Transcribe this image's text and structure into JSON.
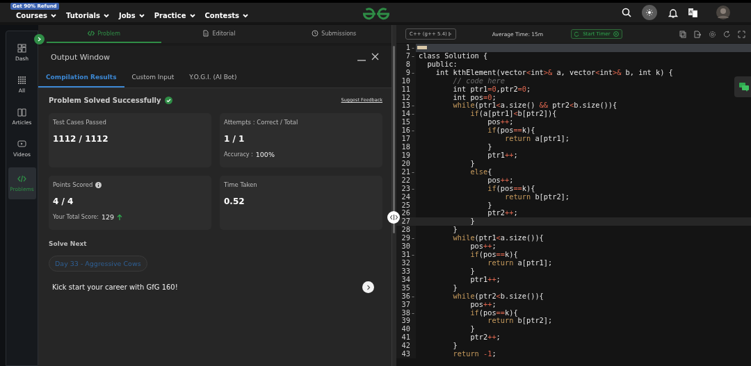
{
  "promo_badge": "Get 90% Refund",
  "nav": {
    "items": [
      {
        "label": "Courses"
      },
      {
        "label": "Tutorials"
      },
      {
        "label": "Jobs"
      },
      {
        "label": "Practice"
      },
      {
        "label": "Contests"
      }
    ]
  },
  "sidebar": {
    "items": [
      {
        "label": "Dash",
        "selected": false
      },
      {
        "label": "All",
        "selected": false
      },
      {
        "label": "Articles",
        "selected": false
      },
      {
        "label": "Videos",
        "selected": false
      },
      {
        "label": "Problems",
        "selected": true
      }
    ]
  },
  "problem_tabs": [
    {
      "label": "Problem",
      "selected": true
    },
    {
      "label": "Editorial",
      "selected": false
    },
    {
      "label": "Submissions",
      "selected": false
    }
  ],
  "output_window": {
    "title": "Output Window",
    "tabs": [
      {
        "label": "Compilation Results",
        "selected": true
      },
      {
        "label": "Custom Input",
        "selected": false
      },
      {
        "label": "Y.O.G.I. (AI Bot)",
        "selected": false
      }
    ],
    "status": "Problem Solved Successfully",
    "feedback_link": "Suggest Feedback",
    "cards": [
      {
        "label": "Test Cases Passed",
        "value": "1112 / 1112"
      },
      {
        "label": "Attempts : Correct / Total",
        "value": "1 / 1",
        "detail_label": "Accuracy :",
        "detail_value": "100%"
      },
      {
        "label": "Points Scored",
        "value": "4 / 4",
        "info": true,
        "detail_label": "Your Total Score:",
        "detail_value": "129",
        "score_increased": true
      },
      {
        "label": "Time Taken",
        "value": "0.52"
      }
    ],
    "solve_next": {
      "heading": "Solve Next",
      "chip": "Day 33 - Aggressive Cows",
      "promo": "Kick start your career with GfG 160!"
    }
  },
  "editor": {
    "language": "C++ (g++ 5.4)",
    "average_time": "Average Time: 15m",
    "timer_button": "Start Timer",
    "lines": [
      {
        "n": "1",
        "fold": true,
        "folded": true,
        "active": false
      },
      {
        "n": "7",
        "fold": true,
        "active": false,
        "segs": [
          {
            "t": "class Solution {",
            "kind": "plain"
          }
        ]
      },
      {
        "n": "8",
        "fold": false,
        "active": false,
        "segs": [
          {
            "t": "  public:",
            "kind": "plain"
          }
        ]
      },
      {
        "n": "9",
        "fold": true,
        "active": false,
        "segs": [
          {
            "t": "    int kthElement(vector",
            "kind": "plain"
          },
          {
            "t": "<",
            "kind": "op"
          },
          {
            "t": "int",
            "kind": "plain"
          },
          {
            "t": ">&",
            "kind": "op"
          },
          {
            "t": " a, vector",
            "kind": "plain"
          },
          {
            "t": "<",
            "kind": "op"
          },
          {
            "t": "int",
            "kind": "plain"
          },
          {
            "t": ">&",
            "kind": "op"
          },
          {
            "t": " b, int k) {",
            "kind": "plain"
          }
        ]
      },
      {
        "n": "10",
        "fold": false,
        "active": false,
        "segs": [
          {
            "t": "        // code here",
            "kind": "comment"
          }
        ]
      },
      {
        "n": "11",
        "fold": false,
        "active": false,
        "segs": [
          {
            "t": "        int ptr1",
            "kind": "plain"
          },
          {
            "t": "=0",
            "kind": "op"
          },
          {
            "t": ",ptr2",
            "kind": "plain"
          },
          {
            "t": "=0",
            "kind": "op"
          },
          {
            "t": ";",
            "kind": "plain"
          }
        ]
      },
      {
        "n": "12",
        "fold": false,
        "active": false,
        "segs": [
          {
            "t": "        int pos",
            "kind": "plain"
          },
          {
            "t": "=0",
            "kind": "op"
          },
          {
            "t": ";",
            "kind": "plain"
          }
        ]
      },
      {
        "n": "13",
        "fold": true,
        "active": false,
        "segs": [
          {
            "t": "        while",
            "kind": "keyword"
          },
          {
            "t": "(ptr1",
            "kind": "plain"
          },
          {
            "t": "<",
            "kind": "op"
          },
          {
            "t": "a.size() ",
            "kind": "plain"
          },
          {
            "t": "&&",
            "kind": "op"
          },
          {
            "t": " ptr2",
            "kind": "plain"
          },
          {
            "t": "<",
            "kind": "op"
          },
          {
            "t": "b.size()){",
            "kind": "plain"
          }
        ]
      },
      {
        "n": "14",
        "fold": true,
        "active": false,
        "segs": [
          {
            "t": "            if",
            "kind": "keyword"
          },
          {
            "t": "(a[ptr1]",
            "kind": "plain"
          },
          {
            "t": "<",
            "kind": "op"
          },
          {
            "t": "b[ptr2]){",
            "kind": "plain"
          }
        ]
      },
      {
        "n": "15",
        "fold": false,
        "active": false,
        "segs": [
          {
            "t": "                pos",
            "kind": "plain"
          },
          {
            "t": "++",
            "kind": "op"
          },
          {
            "t": ";",
            "kind": "plain"
          }
        ]
      },
      {
        "n": "16",
        "fold": true,
        "active": false,
        "segs": [
          {
            "t": "                if",
            "kind": "keyword"
          },
          {
            "t": "(pos",
            "kind": "plain"
          },
          {
            "t": "==",
            "kind": "op"
          },
          {
            "t": "k){",
            "kind": "plain"
          }
        ]
      },
      {
        "n": "17",
        "fold": false,
        "active": false,
        "segs": [
          {
            "t": "                    return",
            "kind": "keyword"
          },
          {
            "t": " a[ptr1];",
            "kind": "plain"
          }
        ]
      },
      {
        "n": "18",
        "fold": false,
        "active": false,
        "segs": [
          {
            "t": "                }",
            "kind": "plain"
          }
        ]
      },
      {
        "n": "19",
        "fold": false,
        "active": false,
        "segs": [
          {
            "t": "                ptr1",
            "kind": "plain"
          },
          {
            "t": "++",
            "kind": "op"
          },
          {
            "t": ";",
            "kind": "plain"
          }
        ]
      },
      {
        "n": "20",
        "fold": false,
        "active": false,
        "segs": [
          {
            "t": "            }",
            "kind": "plain"
          }
        ]
      },
      {
        "n": "21",
        "fold": true,
        "active": false,
        "segs": [
          {
            "t": "            else",
            "kind": "keyword"
          },
          {
            "t": "{",
            "kind": "plain"
          }
        ]
      },
      {
        "n": "22",
        "fold": false,
        "active": false,
        "segs": [
          {
            "t": "                pos",
            "kind": "plain"
          },
          {
            "t": "++",
            "kind": "op"
          },
          {
            "t": ";",
            "kind": "plain"
          }
        ]
      },
      {
        "n": "23",
        "fold": true,
        "active": false,
        "segs": [
          {
            "t": "                if",
            "kind": "keyword"
          },
          {
            "t": "(pos",
            "kind": "plain"
          },
          {
            "t": "==",
            "kind": "op"
          },
          {
            "t": "k){",
            "kind": "plain"
          }
        ]
      },
      {
        "n": "24",
        "fold": false,
        "active": false,
        "segs": [
          {
            "t": "                    return",
            "kind": "keyword"
          },
          {
            "t": " b[ptr2];",
            "kind": "plain"
          }
        ]
      },
      {
        "n": "25",
        "fold": false,
        "active": false,
        "segs": [
          {
            "t": "                }",
            "kind": "plain"
          }
        ]
      },
      {
        "n": "26",
        "fold": false,
        "active": false,
        "segs": [
          {
            "t": "                ptr2",
            "kind": "plain"
          },
          {
            "t": "++",
            "kind": "op"
          },
          {
            "t": ";",
            "kind": "plain"
          }
        ]
      },
      {
        "n": "27",
        "fold": false,
        "active": true,
        "segs": [
          {
            "t": "            }",
            "kind": "plain"
          }
        ]
      },
      {
        "n": "28",
        "fold": false,
        "active": false,
        "segs": [
          {
            "t": "        }",
            "kind": "plain"
          }
        ]
      },
      {
        "n": "29",
        "fold": true,
        "active": false,
        "segs": [
          {
            "t": "        while",
            "kind": "keyword"
          },
          {
            "t": "(ptr1",
            "kind": "plain"
          },
          {
            "t": "<",
            "kind": "op"
          },
          {
            "t": "a.size()){",
            "kind": "plain"
          }
        ]
      },
      {
        "n": "30",
        "fold": false,
        "active": false,
        "segs": [
          {
            "t": "            pos",
            "kind": "plain"
          },
          {
            "t": "++",
            "kind": "op"
          },
          {
            "t": ";",
            "kind": "plain"
          }
        ]
      },
      {
        "n": "31",
        "fold": true,
        "active": false,
        "segs": [
          {
            "t": "            if",
            "kind": "keyword"
          },
          {
            "t": "(pos",
            "kind": "plain"
          },
          {
            "t": "==",
            "kind": "op"
          },
          {
            "t": "k){",
            "kind": "plain"
          }
        ]
      },
      {
        "n": "32",
        "fold": false,
        "active": false,
        "segs": [
          {
            "t": "                return",
            "kind": "keyword"
          },
          {
            "t": " a[ptr1];",
            "kind": "plain"
          }
        ]
      },
      {
        "n": "33",
        "fold": false,
        "active": false,
        "segs": [
          {
            "t": "            }",
            "kind": "plain"
          }
        ]
      },
      {
        "n": "34",
        "fold": false,
        "active": false,
        "segs": [
          {
            "t": "            ptr1",
            "kind": "plain"
          },
          {
            "t": "++",
            "kind": "op"
          },
          {
            "t": ";",
            "kind": "plain"
          }
        ]
      },
      {
        "n": "35",
        "fold": false,
        "active": false,
        "segs": [
          {
            "t": "        }",
            "kind": "plain"
          }
        ]
      },
      {
        "n": "36",
        "fold": true,
        "active": false,
        "segs": [
          {
            "t": "        while",
            "kind": "keyword"
          },
          {
            "t": "(ptr2",
            "kind": "plain"
          },
          {
            "t": "<",
            "kind": "op"
          },
          {
            "t": "b.size()){",
            "kind": "plain"
          }
        ]
      },
      {
        "n": "37",
        "fold": false,
        "active": false,
        "segs": [
          {
            "t": "            pos",
            "kind": "plain"
          },
          {
            "t": "++",
            "kind": "op"
          },
          {
            "t": ";",
            "kind": "plain"
          }
        ]
      },
      {
        "n": "38",
        "fold": true,
        "active": false,
        "segs": [
          {
            "t": "            if",
            "kind": "keyword"
          },
          {
            "t": "(pos",
            "kind": "plain"
          },
          {
            "t": "==",
            "kind": "op"
          },
          {
            "t": "k){",
            "kind": "plain"
          }
        ]
      },
      {
        "n": "39",
        "fold": false,
        "active": false,
        "segs": [
          {
            "t": "                return",
            "kind": "keyword"
          },
          {
            "t": " b[ptr2];",
            "kind": "plain"
          }
        ]
      },
      {
        "n": "40",
        "fold": false,
        "active": false,
        "segs": [
          {
            "t": "            }",
            "kind": "plain"
          }
        ]
      },
      {
        "n": "41",
        "fold": false,
        "active": false,
        "segs": [
          {
            "t": "            ptr2",
            "kind": "plain"
          },
          {
            "t": "++",
            "kind": "op"
          },
          {
            "t": ";",
            "kind": "plain"
          }
        ]
      },
      {
        "n": "42",
        "fold": false,
        "active": false,
        "segs": [
          {
            "t": "        }",
            "kind": "plain"
          }
        ]
      },
      {
        "n": "43",
        "fold": false,
        "active": false,
        "segs": [
          {
            "t": "        return",
            "kind": "keyword"
          },
          {
            "t": " -1",
            "kind": "op"
          },
          {
            "t": ";",
            "kind": "plain"
          }
        ]
      }
    ]
  }
}
